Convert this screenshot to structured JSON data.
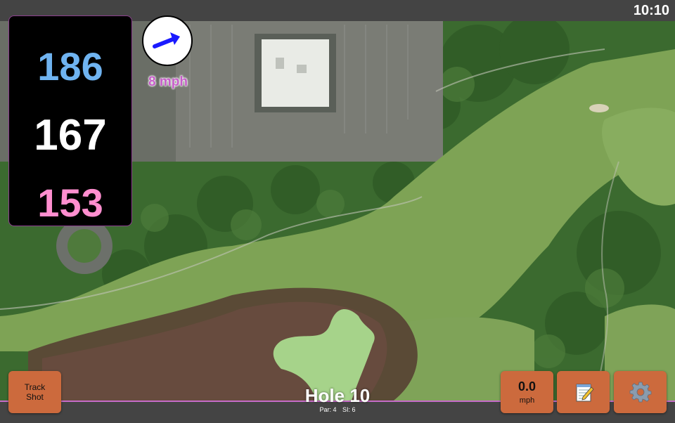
{
  "status_bar": {
    "time": "10:10"
  },
  "distances": {
    "back": "186",
    "middle": "167",
    "front": "153",
    "colors": {
      "back": "#6fb3f0",
      "middle": "#ffffff",
      "front": "#ff8ecf"
    }
  },
  "wind": {
    "speed": "8 mph",
    "direction_icon": "arrow-icon"
  },
  "buttons": {
    "track_shot": {
      "line1": "Track",
      "line2": "Shot"
    },
    "speed": {
      "value": "0.0",
      "unit": "mph"
    },
    "notes": {
      "icon": "notepad-icon"
    },
    "settings": {
      "icon": "gear-icon"
    }
  },
  "hole": {
    "title": "Hole 10",
    "par": "Par: 4",
    "stroke_index": "SI: 6"
  },
  "theme": {
    "accent": "#c66cc9",
    "button": "#cc6a3d",
    "wind_arrow": "#1a1aff"
  }
}
